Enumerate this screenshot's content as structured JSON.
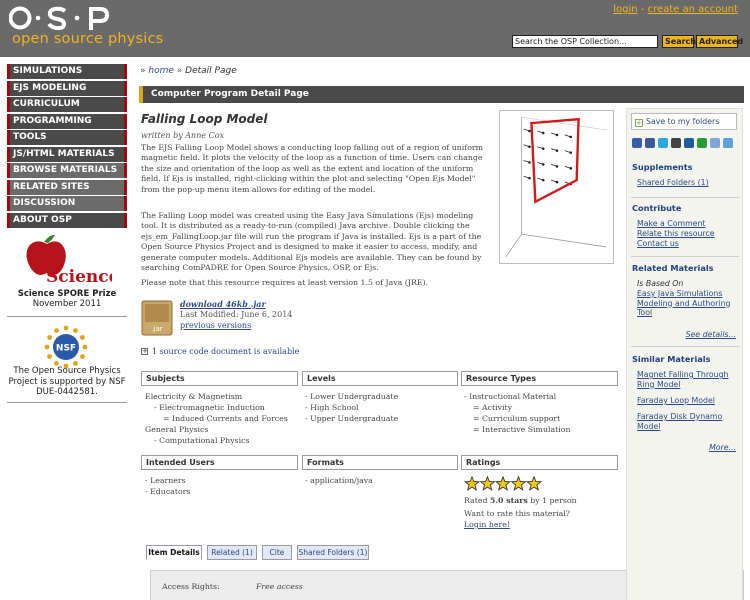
{
  "header": {
    "logo_text": "open source physics",
    "login": "login",
    "separator": " - ",
    "create_account": "create an account",
    "search_placeholder": "Search the OSP Collection...",
    "search_button": "Search",
    "advanced_button": "Advanced"
  },
  "nav": {
    "items": [
      {
        "label": "SIMULATIONS"
      },
      {
        "label": "EJS MODELING"
      },
      {
        "label": "CURRICULUM"
      },
      {
        "label": "PROGRAMMING"
      },
      {
        "label": "TOOLS"
      },
      {
        "label": "JS/HTML MATERIALS"
      },
      {
        "label": "BROWSE MATERIALS"
      },
      {
        "label": "RELATED SITES"
      },
      {
        "label": "DISCUSSION"
      },
      {
        "label": "ABOUT OSP"
      }
    ]
  },
  "left_panel": {
    "science_logo_text": "Science",
    "prize_title": "Science SPORE Prize",
    "prize_date": "November 2011",
    "nsf_logo_text": "NSF",
    "nsf_line1": "The Open Source Physics",
    "nsf_line2": "Project is supported by NSF",
    "nsf_line3": "DUE-0442581."
  },
  "breadcrumb": {
    "home": "home",
    "separator": "»",
    "current": "Detail Page"
  },
  "detail_bar": "Computer Program Detail Page",
  "resource": {
    "title": "Falling Loop Model",
    "author": "written by Anne Cox",
    "description_1": "The EJS Falling Loop Model shows a conducting loop falling out of a region of uniform magnetic field. It plots the velocity of the loop as a function of time. Users can change the size and orientation of the loop as well as the extent and location of the uniform field. If Ejs is installed, right-clicking within the plot and selecting \"Open Ejs Model\" from the pop-up menu item allows for editing of the model.",
    "description_2": "The Falling Loop model was created using the Easy Java Simulations (Ejs) modeling tool.  It is distributed as a ready-to-run (compiled) Java archive.  Double clicking the ejs_em_FallingLoop.jar file will run the program if Java is installed.  Ejs is a part of the Open Source Physics Project and is designed to make it easier to access, modify, and generate computer models.  Additional Ejs models are available.  They can be found by searching ComPADRE for Open Source Physics, OSP, or Ejs.",
    "description_3": "Please note that this resource requires at least version 1.5 of Java (JRE).",
    "jar_label": ".jar",
    "download": "download 46kb .jar",
    "last_modified": "Last Modified: June 6, 2014",
    "previous_versions": "previous versions",
    "source_expand": "+",
    "source_code": "1 source code document is available"
  },
  "subjects": {
    "header": "Subjects",
    "rows": [
      "Electricity & Magnetism",
      "- Electromagnetic Induction",
      "= Induced Currents and Forces",
      "General Physics",
      "- Computational Physics"
    ]
  },
  "levels": {
    "header": "Levels",
    "rows": [
      "- Lower Undergraduate",
      "- High School",
      "- Upper Undergraduate"
    ]
  },
  "resource_types": {
    "header": "Resource Types",
    "rows": [
      "- Instructional Material",
      "= Activity",
      "= Curriculum support",
      "= Interactive Simulation"
    ]
  },
  "intended_users": {
    "header": "Intended Users",
    "rows": [
      "- Learners",
      "- Educators"
    ]
  },
  "formats": {
    "header": "Formats",
    "rows": [
      "- application/java"
    ]
  },
  "ratings": {
    "header": "Ratings",
    "stars_filled": 5,
    "stars_total": 5,
    "rated_prefix": "Rated ",
    "rated_value": "5.0 stars",
    "rated_suffix": " by 1 person",
    "question": "Want to rate this material?",
    "login_link": "Login here!",
    "star_color": "#f5c518"
  },
  "tabs": [
    {
      "label": "Item Details",
      "active": true
    },
    {
      "label": "Related (1)",
      "active": false
    },
    {
      "label": "Cite",
      "active": false
    },
    {
      "label": "Shared Folders (1)",
      "active": false
    }
  ],
  "details": {
    "access_rights_label": "Access Rights:",
    "access_rights_value": "Free access"
  },
  "sidebar": {
    "save_folders": "Save to my folders",
    "save_plus": "+",
    "share_icons": [
      {
        "name": "delicious-icon",
        "color": "#3b5ba8"
      },
      {
        "name": "facebook-icon",
        "color": "#3b5998"
      },
      {
        "name": "twitter-icon",
        "color": "#2aa9e0"
      },
      {
        "name": "delicious-grid-icon",
        "color": "#444444"
      },
      {
        "name": "digg-icon",
        "color": "#1d5e9b"
      },
      {
        "name": "stumbleupon-icon",
        "color": "#2a9a3a"
      },
      {
        "name": "reddit-icon",
        "color": "#7fa7d8"
      },
      {
        "name": "email-icon",
        "color": "#5fa0d8"
      }
    ],
    "supplements": {
      "header": "Supplements",
      "items": [
        "Shared Folders (1)"
      ]
    },
    "contribute": {
      "header": "Contribute",
      "items": [
        "Make a Comment",
        "Relate this resource",
        "Contact us"
      ]
    },
    "related_materials": {
      "header": "Related Materials",
      "is_based_on": "Is Based On",
      "items": [
        "Easy Java Simulations Modeling and Authoring Tool"
      ],
      "see_details": "See details..."
    },
    "similar_materials": {
      "header": "Similar Materials",
      "items": [
        "Magnet Falling Through Ring Model",
        "Faraday Loop Model",
        "Faraday Disk Dynamo Model"
      ],
      "more": "More..."
    }
  }
}
